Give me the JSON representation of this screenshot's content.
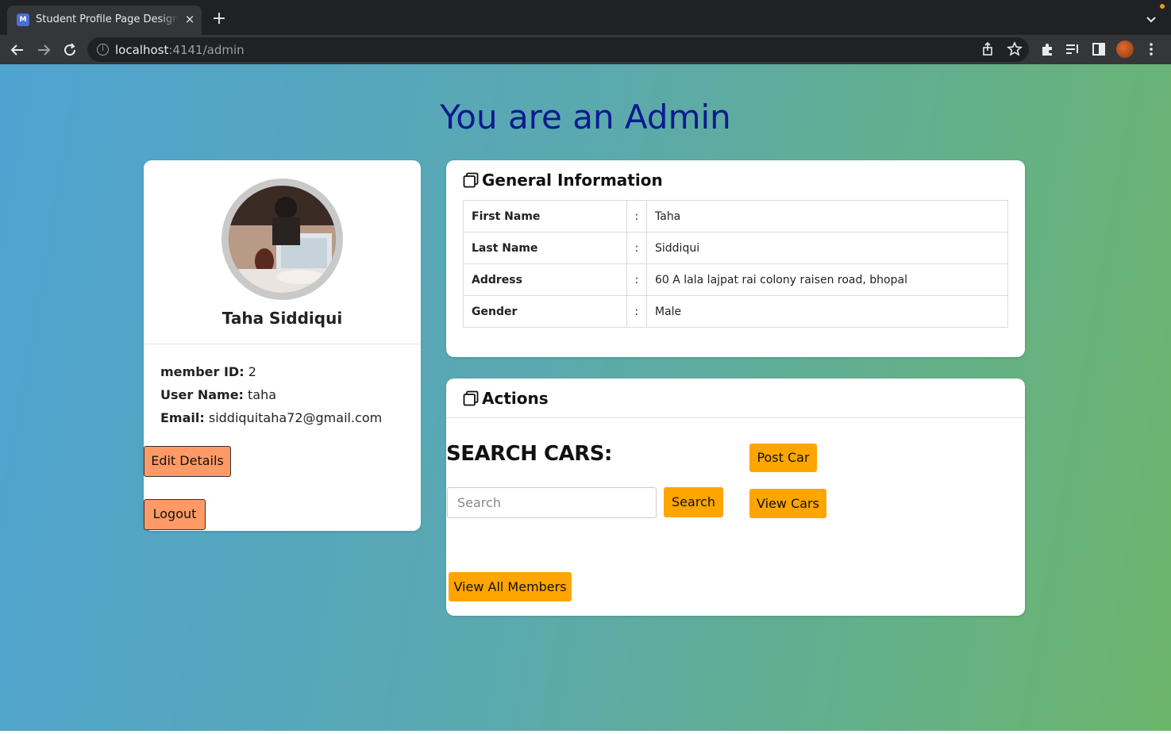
{
  "browser": {
    "tab_title": "Student Profile Page Design Ex",
    "tab_close": "×",
    "new_tab": "+",
    "url_host": "localhost",
    "url_path": ":4141/admin",
    "favicon_text": "M"
  },
  "page": {
    "heading": "You are an Admin"
  },
  "profile": {
    "name": "Taha Siddiqui",
    "member_id_label": "member ID:",
    "member_id": "2",
    "username_label": "User Name:",
    "username": "taha",
    "email_label": "Email:",
    "email": "siddiquitaha72@gmail.com",
    "edit_label": "Edit Details",
    "logout_label": "Logout"
  },
  "general": {
    "title": "General Information",
    "rows": [
      {
        "key": "First Name",
        "sep": ":",
        "value": "Taha"
      },
      {
        "key": "Last Name",
        "sep": ":",
        "value": "Siddiqui"
      },
      {
        "key": "Address",
        "sep": ":",
        "value": "60 A lala lajpat rai colony raisen road, bhopal"
      },
      {
        "key": "Gender",
        "sep": ":",
        "value": "Male"
      }
    ]
  },
  "actions": {
    "title": "Actions",
    "search_title": "SEARCH CARS:",
    "search_placeholder": "Search",
    "search_button": "Search",
    "post_car": "Post Car",
    "view_cars": "View Cars",
    "view_all_members": "View All Members"
  },
  "colors": {
    "heading": "#0c1a8f",
    "action_button": "#ffa500",
    "profile_button": "#ff9a67"
  }
}
